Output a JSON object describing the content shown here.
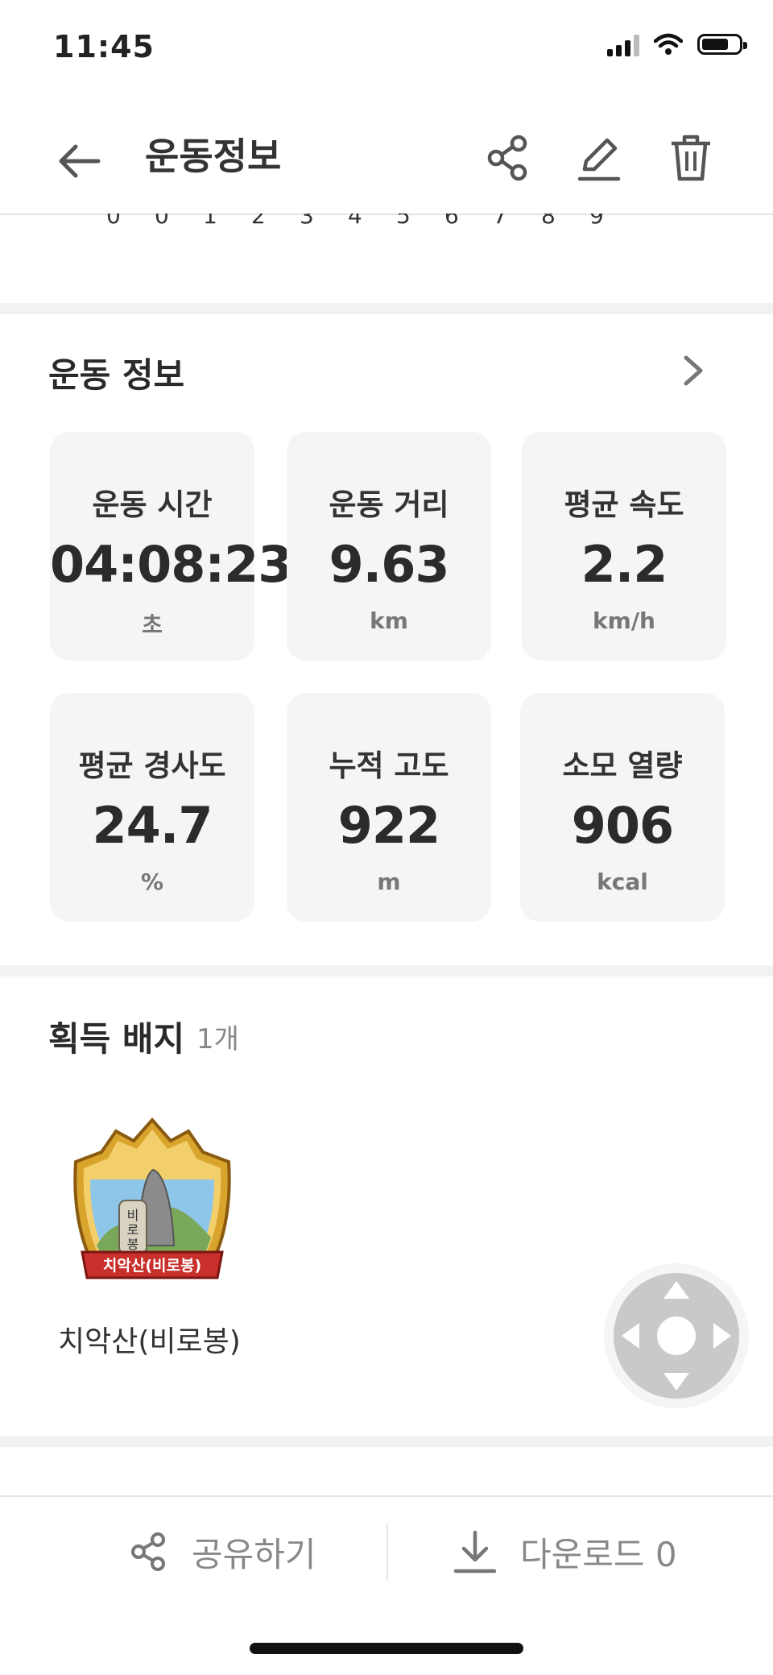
{
  "status_bar": {
    "time": "11:45"
  },
  "header": {
    "title": "운동정보"
  },
  "top_digits": [
    "0",
    "0",
    "1",
    "2",
    "3",
    "4",
    "5",
    "6",
    "7",
    "8",
    "9"
  ],
  "exercise_info": {
    "section_title": "운동 정보",
    "stats": [
      {
        "label": "운동 시간",
        "value": "04:08:23",
        "unit": "초"
      },
      {
        "label": "운동 거리",
        "value": "9.63",
        "unit": "km"
      },
      {
        "label": "평균 속도",
        "value": "2.2",
        "unit": "km/h"
      },
      {
        "label": "평균 경사도",
        "value": "24.7",
        "unit": "%"
      },
      {
        "label": "누적 고도",
        "value": "922",
        "unit": "m"
      },
      {
        "label": "소모 열량",
        "value": "906",
        "unit": "kcal"
      }
    ]
  },
  "badges": {
    "section_title": "획득 배지",
    "count": "1개",
    "items": [
      {
        "name": "치악산(비로봉)",
        "emblem_top": "비로봉",
        "ribbon": "치악산(비로봉)"
      }
    ]
  },
  "bottom_bar": {
    "share_label": "공유하기",
    "download_label": "다운로드 0"
  },
  "colors": {
    "card_bg": "#f5f5f5",
    "divider": "#f1f2f4",
    "muted_text": "#888888"
  }
}
